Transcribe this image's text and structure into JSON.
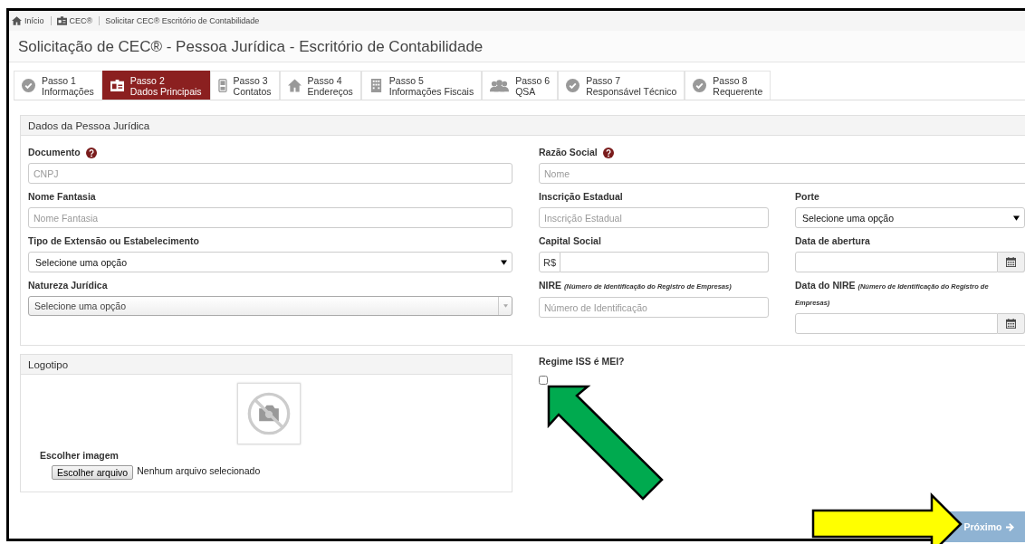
{
  "breadcrumb": [
    {
      "label": "Início",
      "kind": "home"
    },
    {
      "label": "CEC®",
      "kind": "card"
    },
    {
      "label": "Solicitar CEC® Escritório de Contabilidade",
      "kind": "plain"
    }
  ],
  "title": "Solicitação de CEC® - Pessoa Jurídica - Escritório de Contabilidade",
  "steps": [
    {
      "step": "Passo 1",
      "label": "Informações",
      "kind": "check",
      "selected": false
    },
    {
      "step": "Passo 2",
      "label": "Dados Principais",
      "kind": "card",
      "selected": true
    },
    {
      "step": "Passo 3",
      "label": "Contatos",
      "kind": "phone",
      "selected": false
    },
    {
      "step": "Passo 4",
      "label": "Endereços",
      "kind": "home",
      "selected": false
    },
    {
      "step": "Passo 5",
      "label": "Informações Fiscais",
      "kind": "building",
      "selected": false
    },
    {
      "step": "Passo 6",
      "label": "QSA",
      "kind": "users",
      "selected": false
    },
    {
      "step": "Passo 7",
      "label": "Responsável Técnico",
      "kind": "check",
      "selected": false
    },
    {
      "step": "Passo 8",
      "label": "Requerente",
      "kind": "check",
      "selected": false
    }
  ],
  "panel": {
    "title": "Dados da Pessoa Jurídica",
    "left": [
      {
        "label": "Documento",
        "help": true,
        "kind": "text",
        "placeholder": "CNPJ"
      },
      {
        "label": "Nome Fantasia",
        "help": false,
        "kind": "text",
        "placeholder": "Nome Fantasia"
      },
      {
        "label": "Tipo de Extensão ou Estabelecimento",
        "help": false,
        "kind": "select",
        "value": "Selecione uma opção"
      },
      {
        "label": "Natureza Jurídica",
        "help": false,
        "kind": "combo",
        "value": "Selecione uma opção"
      }
    ],
    "right": [
      {
        "label": "Razão Social",
        "help": true,
        "kind": "text",
        "placeholder": "Nome"
      }
    ],
    "grid": [
      {
        "label": "Inscrição Estadual",
        "help": false,
        "kind": "text",
        "placeholder": "Inscrição Estadual"
      },
      {
        "label": "Porte",
        "help": false,
        "kind": "select",
        "value": "Selecione uma opção"
      },
      {
        "label": "Capital Social",
        "help": false,
        "kind": "money",
        "prefix": "R$"
      },
      {
        "label": "Data de abertura",
        "help": false,
        "kind": "date"
      },
      {
        "label": "NIRE *(Número de Identificação do Registro de Empresas)*",
        "help": false,
        "kind": "text",
        "placeholder": "Número de Identificação"
      },
      {
        "label": "Data do NIRE *(Número de Identificação do Registro de Empresas)*",
        "help": false,
        "kind": "date"
      }
    ]
  },
  "logo_panel": {
    "title": "Logotipo",
    "image_label": "Escolher imagem",
    "file_button": "Escolher arquivo",
    "file_status": "Nenhum arquivo selecionado"
  },
  "regime": {
    "label": "Regime ISS é MEI?",
    "checked": false
  },
  "next_button": {
    "label": "Próximo",
    "disabled": true
  }
}
